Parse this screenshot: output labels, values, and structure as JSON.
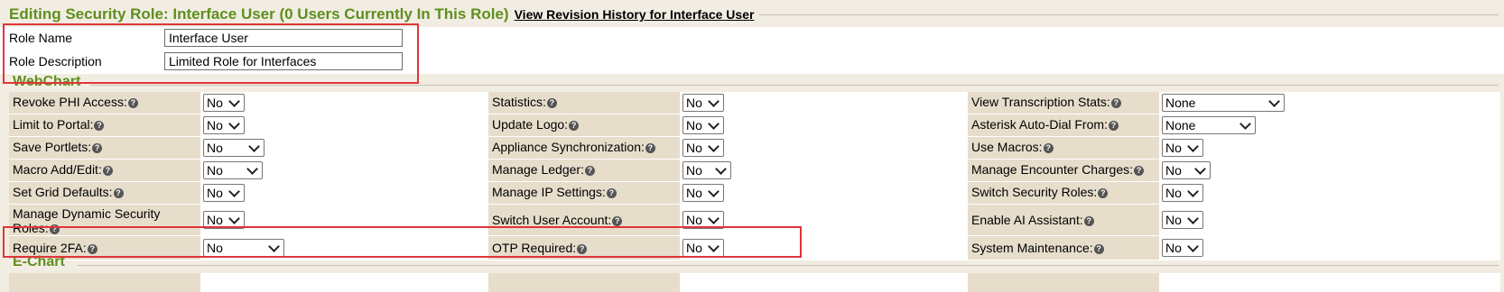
{
  "header": {
    "title": "Editing Security Role: Interface User (0 Users Currently In This Role)",
    "revision_link": "View Revision History for Interface User"
  },
  "role": {
    "name_label": "Role Name",
    "name_value": "Interface User",
    "description_label": "Role Description",
    "description_value": "Limited Role for Interfaces"
  },
  "sections": {
    "webchart": "WebChart",
    "echart": "E-Chart"
  },
  "help_glyph": "?",
  "rows": [
    [
      {
        "label": "Revoke PHI Access:",
        "value": "No"
      },
      {
        "label": "Statistics:",
        "value": "No"
      },
      {
        "label": "View Transcription Stats:",
        "value": "None"
      }
    ],
    [
      {
        "label": "Limit to Portal:",
        "value": "No"
      },
      {
        "label": "Update Logo:",
        "value": "No"
      },
      {
        "label": "Asterisk Auto-Dial From:",
        "value": "None"
      }
    ],
    [
      {
        "label": "Save Portlets:",
        "value": "No"
      },
      {
        "label": "Appliance Synchronization:",
        "value": "No"
      },
      {
        "label": "Use Macros:",
        "value": "No"
      }
    ],
    [
      {
        "label": "Macro Add/Edit:",
        "value": "No"
      },
      {
        "label": "Manage Ledger:",
        "value": "No"
      },
      {
        "label": "Manage Encounter Charges:",
        "value": "No"
      }
    ],
    [
      {
        "label": "Set Grid Defaults:",
        "value": "No"
      },
      {
        "label": "Manage IP Settings:",
        "value": "No"
      },
      {
        "label": "Switch Security Roles:",
        "value": "No"
      }
    ],
    [
      {
        "label": "Manage Dynamic Security Roles:",
        "value": "No"
      },
      {
        "label": "Switch User Account:",
        "value": "No"
      },
      {
        "label": "Enable AI Assistant:",
        "value": "No"
      }
    ],
    [
      {
        "label": "Require 2FA:",
        "value": "No"
      },
      {
        "label": "OTP Required:",
        "value": "No"
      },
      {
        "label": "System Maintenance:",
        "value": "No"
      }
    ]
  ],
  "colors": {
    "section_green": "#5e8f1e",
    "label_bg": "#e6ddcb",
    "highlight_red": "#e0343b"
  }
}
